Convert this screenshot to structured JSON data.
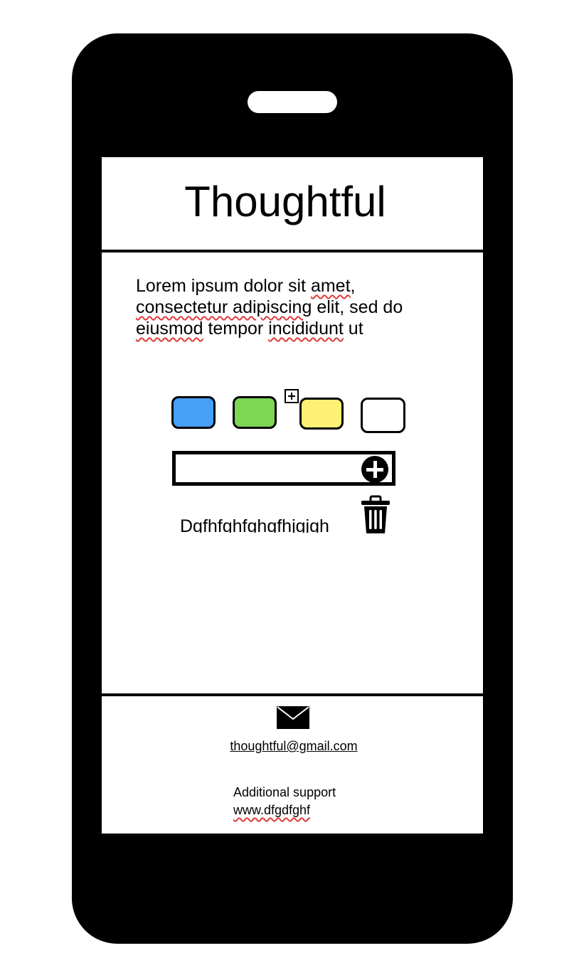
{
  "app": {
    "title": "Thoughtful"
  },
  "main": {
    "intro_text": "Lorem ipsum dolor sit amet, consectetur adipiscing elit, sed do eiusmod tempor incididunt ut",
    "color_swatches": [
      {
        "name": "blue",
        "color": "#46a0f8"
      },
      {
        "name": "green",
        "color": "#7fd655"
      },
      {
        "name": "yellow",
        "color": "#fdf074"
      },
      {
        "name": "white",
        "color": "#ffffff"
      }
    ],
    "add_swatch_icon": "plus-square-icon",
    "entry": {
      "value": "",
      "placeholder": "",
      "add_icon": "plus-circle-icon"
    },
    "items": [
      {
        "text": "Dgfhfghfghgfhjgjgh",
        "delete_icon": "trash-icon"
      }
    ]
  },
  "footer": {
    "mail_icon": "envelope-icon",
    "email": "thoughtful@gmail.com",
    "support_label": "Additional support",
    "support_url": "www.dfgdfghf"
  },
  "colors": {
    "device": "#000000",
    "screen": "#ffffff",
    "spellcheck_underline": "#e23b3b"
  }
}
